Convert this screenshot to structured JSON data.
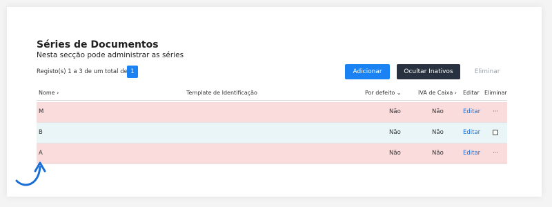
{
  "page": {
    "title": "Séries de Documentos",
    "subtitle": "Nesta secção pode administrar as séries"
  },
  "pagination": {
    "summary": "Registo(s) 1 a 3 de um total de 3",
    "current_page": "1"
  },
  "toolbar": {
    "add_label": "Adicionar",
    "hide_inactive_label": "Ocultar Inativos",
    "delete_label": "Eliminar"
  },
  "table": {
    "headers": {
      "name": "Nome ›",
      "template": "Template de Identificação",
      "default": "Por defeito ⌄",
      "iva": "IVA de Caixa ›",
      "edit": "Editar",
      "remove": "Eliminar"
    },
    "rows": [
      {
        "name": "M",
        "template": "",
        "default": "Não",
        "iva": "Não",
        "edit": "Editar",
        "remove": "···",
        "status": "inactive"
      },
      {
        "name": "B",
        "template": "",
        "default": "Não",
        "iva": "Não",
        "edit": "Editar",
        "remove": "checkbox",
        "status": "active"
      },
      {
        "name": "A",
        "template": "",
        "default": "Não",
        "iva": "Não",
        "edit": "Editar",
        "remove": "···",
        "status": "inactive"
      }
    ]
  },
  "colors": {
    "primary": "#1a82f2",
    "dark_button": "#27313f",
    "inactive_row": "#fadcdc",
    "active_row": "#eaf5f8",
    "link": "#1a6fd6",
    "arrow": "#1a6fd6"
  },
  "icons": {
    "pointer": "curved-arrow-up-icon"
  }
}
